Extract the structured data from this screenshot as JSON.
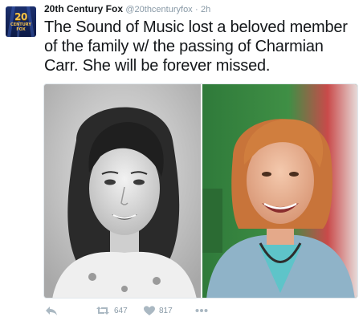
{
  "author": {
    "name": "20th Century Fox",
    "handle": "@20thcenturyfox",
    "separator": "·",
    "time": "2h",
    "avatar_text": "20",
    "avatar_subtext": "CENTURY FOX"
  },
  "tweet": {
    "text": "The Sound of Music lost a beloved member of the family w/ the passing of Charmian Carr. She will be forever missed."
  },
  "media": {
    "left_photo": "photo",
    "right_photo": "photo"
  },
  "actions": {
    "reply_icon": "reply-icon",
    "retweet_icon": "retweet-icon",
    "retweet_count": "647",
    "like_icon": "heart-icon",
    "like_count": "817",
    "more_icon": "more-icon"
  },
  "colors": {
    "text": "#14171a",
    "muted": "#8899a6",
    "icon": "#aab8c2",
    "brand_gold": "#f2c14e",
    "brand_navy": "#1b2f6e"
  }
}
